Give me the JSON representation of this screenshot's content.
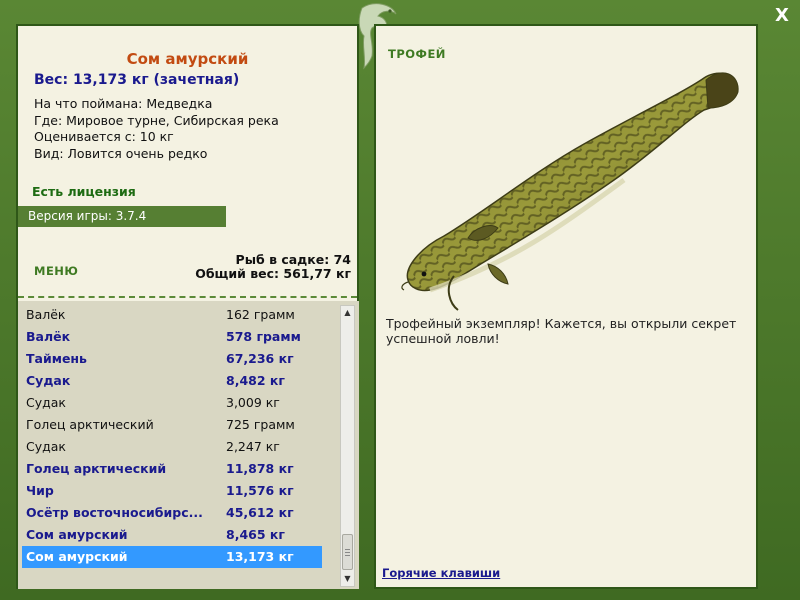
{
  "window": {
    "close_label": "X"
  },
  "fish": {
    "title": "Сом амурский",
    "weight_line": "Вес: 13,173 кг (зачетная)",
    "bait_line": "На что поймана: Медведка",
    "place_line": "Где: Мировое турне, Сибирская река",
    "rated_line": "Оценивается с: 10 кг",
    "type_line": "Вид: Ловится очень редко"
  },
  "license_label": "Есть лицензия",
  "version_label": "Версия игры: 3.7.4",
  "menu_label": "МЕНЮ",
  "stats": {
    "fish_in_net": "Рыб в садке: 74",
    "total_weight": "Общий вес: 561,77 кг"
  },
  "catch_list": [
    {
      "name": "Валёк",
      "weight": "162 грамм",
      "style": "normal"
    },
    {
      "name": "Валёк",
      "weight": "578 грамм",
      "style": "bold"
    },
    {
      "name": "Таймень",
      "weight": "67,236 кг",
      "style": "bold"
    },
    {
      "name": "Судак",
      "weight": "8,482 кг",
      "style": "bold"
    },
    {
      "name": "Судак",
      "weight": "3,009 кг",
      "style": "normal"
    },
    {
      "name": "Голец арктический",
      "weight": "725 грамм",
      "style": "normal"
    },
    {
      "name": "Судак",
      "weight": "2,247 кг",
      "style": "normal"
    },
    {
      "name": "Голец арктический",
      "weight": "11,878 кг",
      "style": "bold"
    },
    {
      "name": "Чир",
      "weight": "11,576 кг",
      "style": "bold"
    },
    {
      "name": "Осётр восточносибирс...",
      "weight": "45,612 кг",
      "style": "bold"
    },
    {
      "name": "Сом амурский",
      "weight": "8,465 кг",
      "style": "bold"
    },
    {
      "name": "Сом амурский",
      "weight": "13,173 кг",
      "style": "selected"
    }
  ],
  "trophy": {
    "label": "ТРОФЕЙ",
    "description": "Трофейный экземпляр! Кажется, вы открыли секрет успешной ловли!"
  },
  "hotkeys_label": "Горячие клавиши",
  "colors": {
    "frame": "#4f7a2c",
    "panel": "#f4f2e2",
    "title": "#c24b12",
    "accent_blue": "#1a1a8e",
    "selection": "#3399ff"
  }
}
